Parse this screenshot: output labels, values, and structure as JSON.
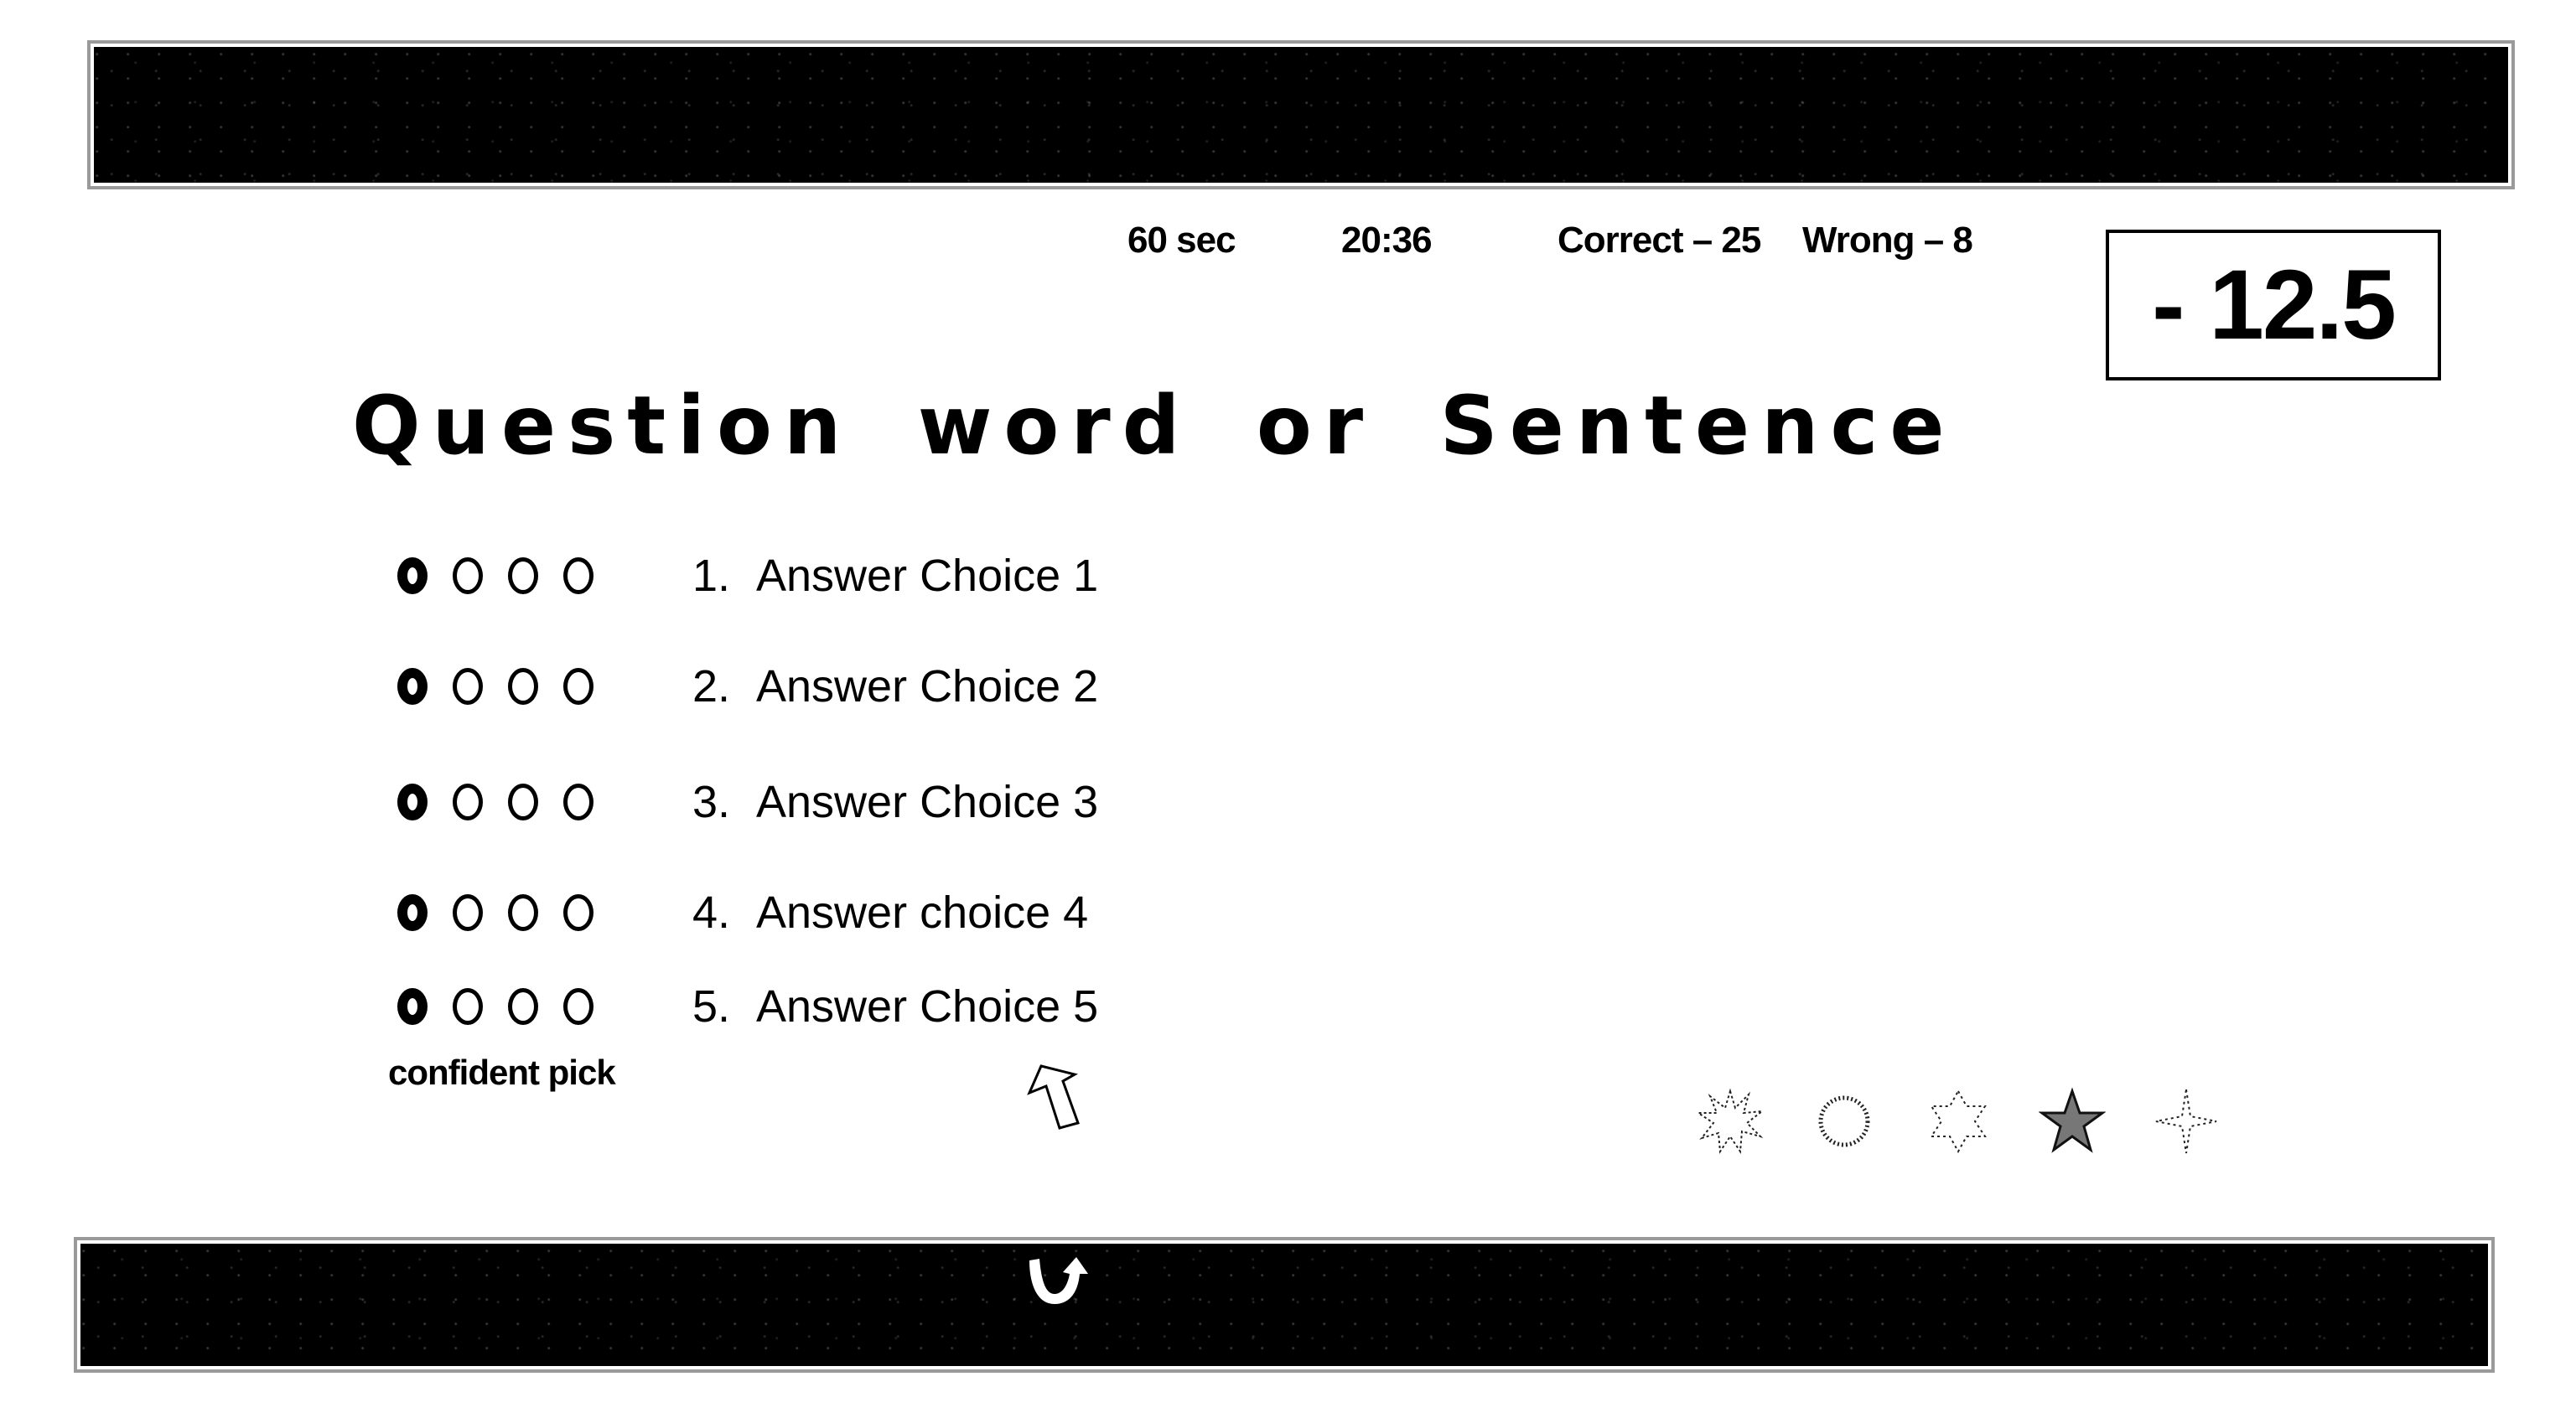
{
  "header": {
    "timer_label": "60 sec",
    "clock": "20:36",
    "correct_label": "Correct – 25",
    "wrong_label": "Wrong – 8",
    "correct_count": 25,
    "wrong_count": 8,
    "score": "- 12.5"
  },
  "question": {
    "text": "Question word or Sentence"
  },
  "answers": [
    {
      "number": "1.",
      "text": "Answer Choice 1"
    },
    {
      "number": "2.",
      "text": "Answer Choice 2"
    },
    {
      "number": "3.",
      "text": "Answer Choice 3"
    },
    {
      "number": "4.",
      "text": "Answer choice 4"
    },
    {
      "number": "5.",
      "text": "Answer Choice 5"
    }
  ],
  "confidence": {
    "label": "confident pick",
    "levels_per_answer": 4,
    "bold_level_index": 0
  },
  "badges": [
    {
      "icon": "burst-icon",
      "selected": false
    },
    {
      "icon": "sun-ring-icon",
      "selected": false
    },
    {
      "icon": "six-point-star-icon",
      "selected": false
    },
    {
      "icon": "five-point-star-icon",
      "selected": true
    },
    {
      "icon": "sparkle-star-icon",
      "selected": false
    }
  ],
  "navigation": {
    "next_icon": "u-turn-arrow-icon",
    "cursor_icon": "outline-up-arrow-icon"
  },
  "colors": {
    "banner": "#000000",
    "text": "#000000",
    "background": "#ffffff"
  }
}
